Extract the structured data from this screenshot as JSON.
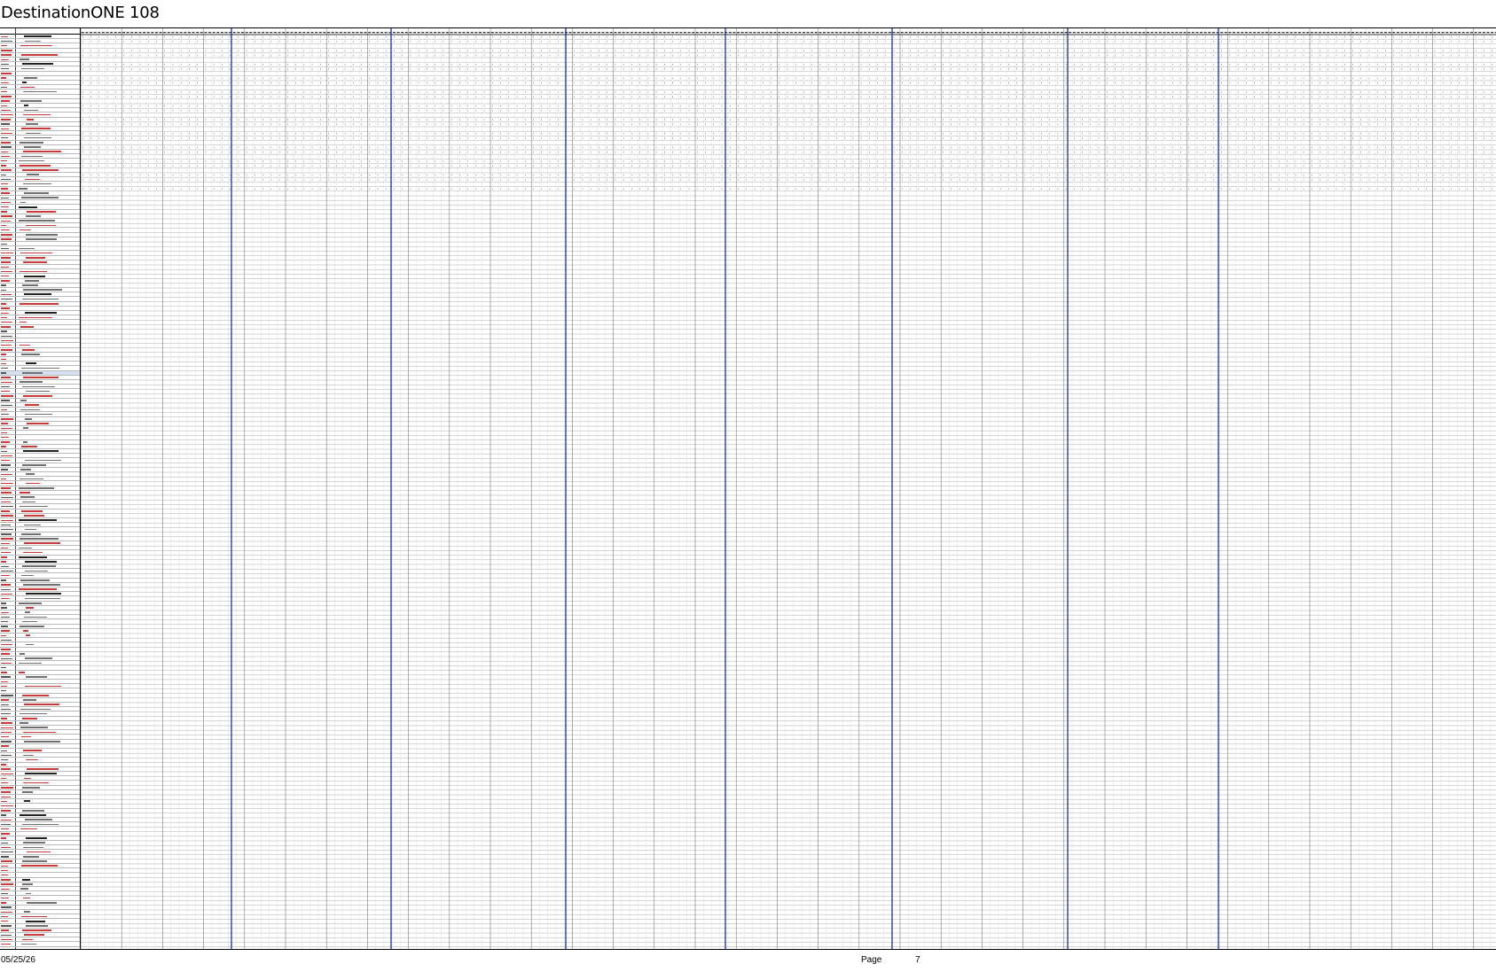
{
  "document": {
    "title": "DestinationONE 108",
    "footer": {
      "date": "05/25/26",
      "page_label": "Page",
      "page_number": "7"
    },
    "colors": {
      "grid_line": "#8a8a8a",
      "group_divider": "#1c2f8f",
      "code_text": "#c83a3a",
      "row_highlight": "#d6e2f4"
    }
  }
}
